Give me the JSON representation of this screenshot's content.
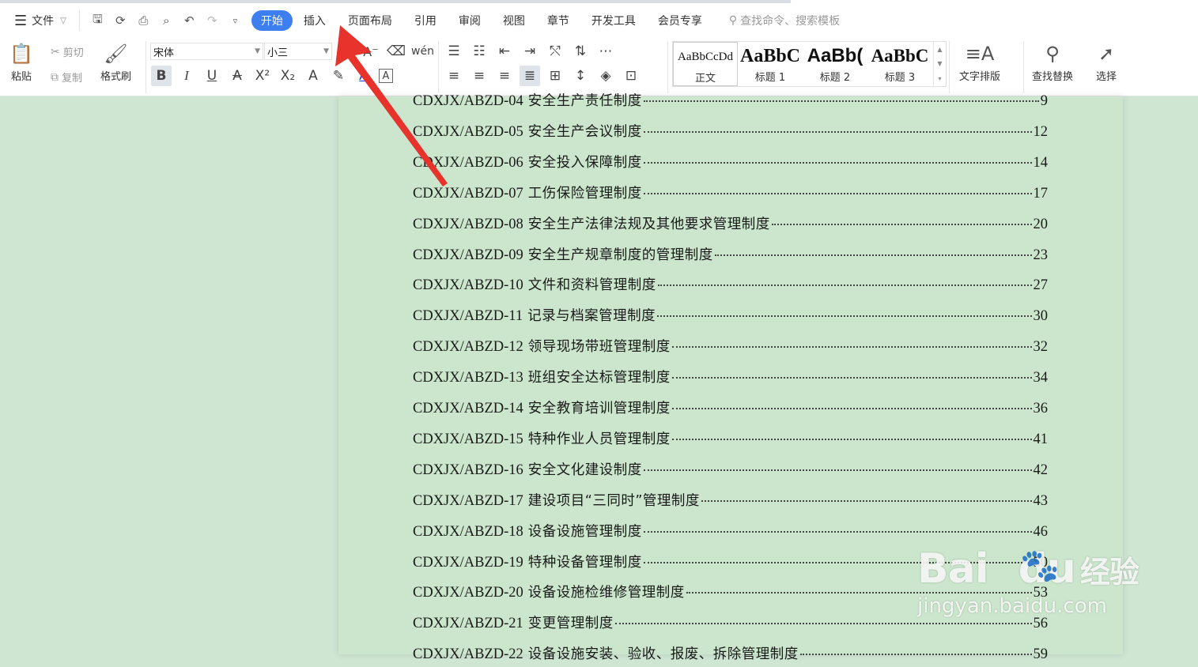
{
  "menubar": {
    "file_label": "文件",
    "tabs": [
      {
        "label": "开始",
        "active": true
      },
      {
        "label": "插入"
      },
      {
        "label": "页面布局"
      },
      {
        "label": "引用"
      },
      {
        "label": "审阅"
      },
      {
        "label": "视图"
      },
      {
        "label": "章节"
      },
      {
        "label": "开发工具"
      },
      {
        "label": "会员专享"
      }
    ],
    "search_placeholder": "查找命令、搜索模板",
    "quick_access_icons": [
      "save-icon",
      "format-painter-icon",
      "print-icon",
      "print-preview-icon",
      "undo-icon",
      "redo-icon",
      "customize-icon"
    ]
  },
  "ribbon": {
    "paste_label": "粘贴",
    "cut_label": "剪切",
    "copy_label": "复制",
    "format_painter_label": "格式刷",
    "font_name": "宋体",
    "font_size": "小三",
    "styles": [
      {
        "sample": "AaBbCcDd",
        "label": "正文"
      },
      {
        "sample": "AaBbC",
        "label": "标题 1"
      },
      {
        "sample": "AaBb(",
        "label": "标题 2"
      },
      {
        "sample": "AaBbC",
        "label": "标题 3"
      }
    ],
    "text_layout_label": "文字排版",
    "find_replace_label": "查找替换",
    "select_label": "选择"
  },
  "document": {
    "toc": [
      {
        "code": "CDXJX/ABZD-04",
        "title": "安全生产责任制度",
        "page": "9"
      },
      {
        "code": "CDXJX/ABZD-05",
        "title": "安全生产会议制度",
        "page": "12"
      },
      {
        "code": "CDXJX/ABZD-06",
        "title": "安全投入保障制度",
        "page": "14"
      },
      {
        "code": "CDXJX/ABZD-07",
        "title": "工伤保险管理制度",
        "page": "17"
      },
      {
        "code": "CDXJX/ABZD-08",
        "title": "安全生产法律法规及其他要求管理制度",
        "page": "20"
      },
      {
        "code": "CDXJX/ABZD-09",
        "title": "安全生产规章制度的管理制度",
        "page": "23"
      },
      {
        "code": "CDXJX/ABZD-10",
        "title": "文件和资料管理制度",
        "page": "27"
      },
      {
        "code": "CDXJX/ABZD-11",
        "title": "记录与档案管理制度",
        "page": "30"
      },
      {
        "code": "CDXJX/ABZD-12",
        "title": "领导现场带班管理制度",
        "page": "32"
      },
      {
        "code": "CDXJX/ABZD-13",
        "title": "班组安全达标管理制度",
        "page": "34"
      },
      {
        "code": "CDXJX/ABZD-14",
        "title": "安全教育培训管理制度",
        "page": "36"
      },
      {
        "code": "CDXJX/ABZD-15",
        "title": "特种作业人员管理制度",
        "page": "41"
      },
      {
        "code": "CDXJX/ABZD-16",
        "title": "安全文化建设制度",
        "page": "42"
      },
      {
        "code": "CDXJX/ABZD-17",
        "title": "建设项目“三同时”管理制度",
        "page": "43"
      },
      {
        "code": "CDXJX/ABZD-18",
        "title": "设备设施管理制度",
        "page": "46"
      },
      {
        "code": "CDXJX/ABZD-19",
        "title": "特种设备管理制度",
        "page": "50"
      },
      {
        "code": "CDXJX/ABZD-20",
        "title": "设备设施检维修管理制度",
        "page": "53"
      },
      {
        "code": "CDXJX/ABZD-21",
        "title": "变更管理制度",
        "page": "56"
      },
      {
        "code": "CDXJX/ABZD-22",
        "title": "设备设施安装、验收、报废、拆除管理制度",
        "page": "59"
      }
    ]
  },
  "watermark": {
    "brand": "Bai",
    "brand2": "du",
    "cn": "经验",
    "domain": "jingyan.baidu.com"
  },
  "colors": {
    "accent": "#3d7ef0",
    "page_bg": "#cbe6cc",
    "annotation_arrow": "#e8322c"
  }
}
